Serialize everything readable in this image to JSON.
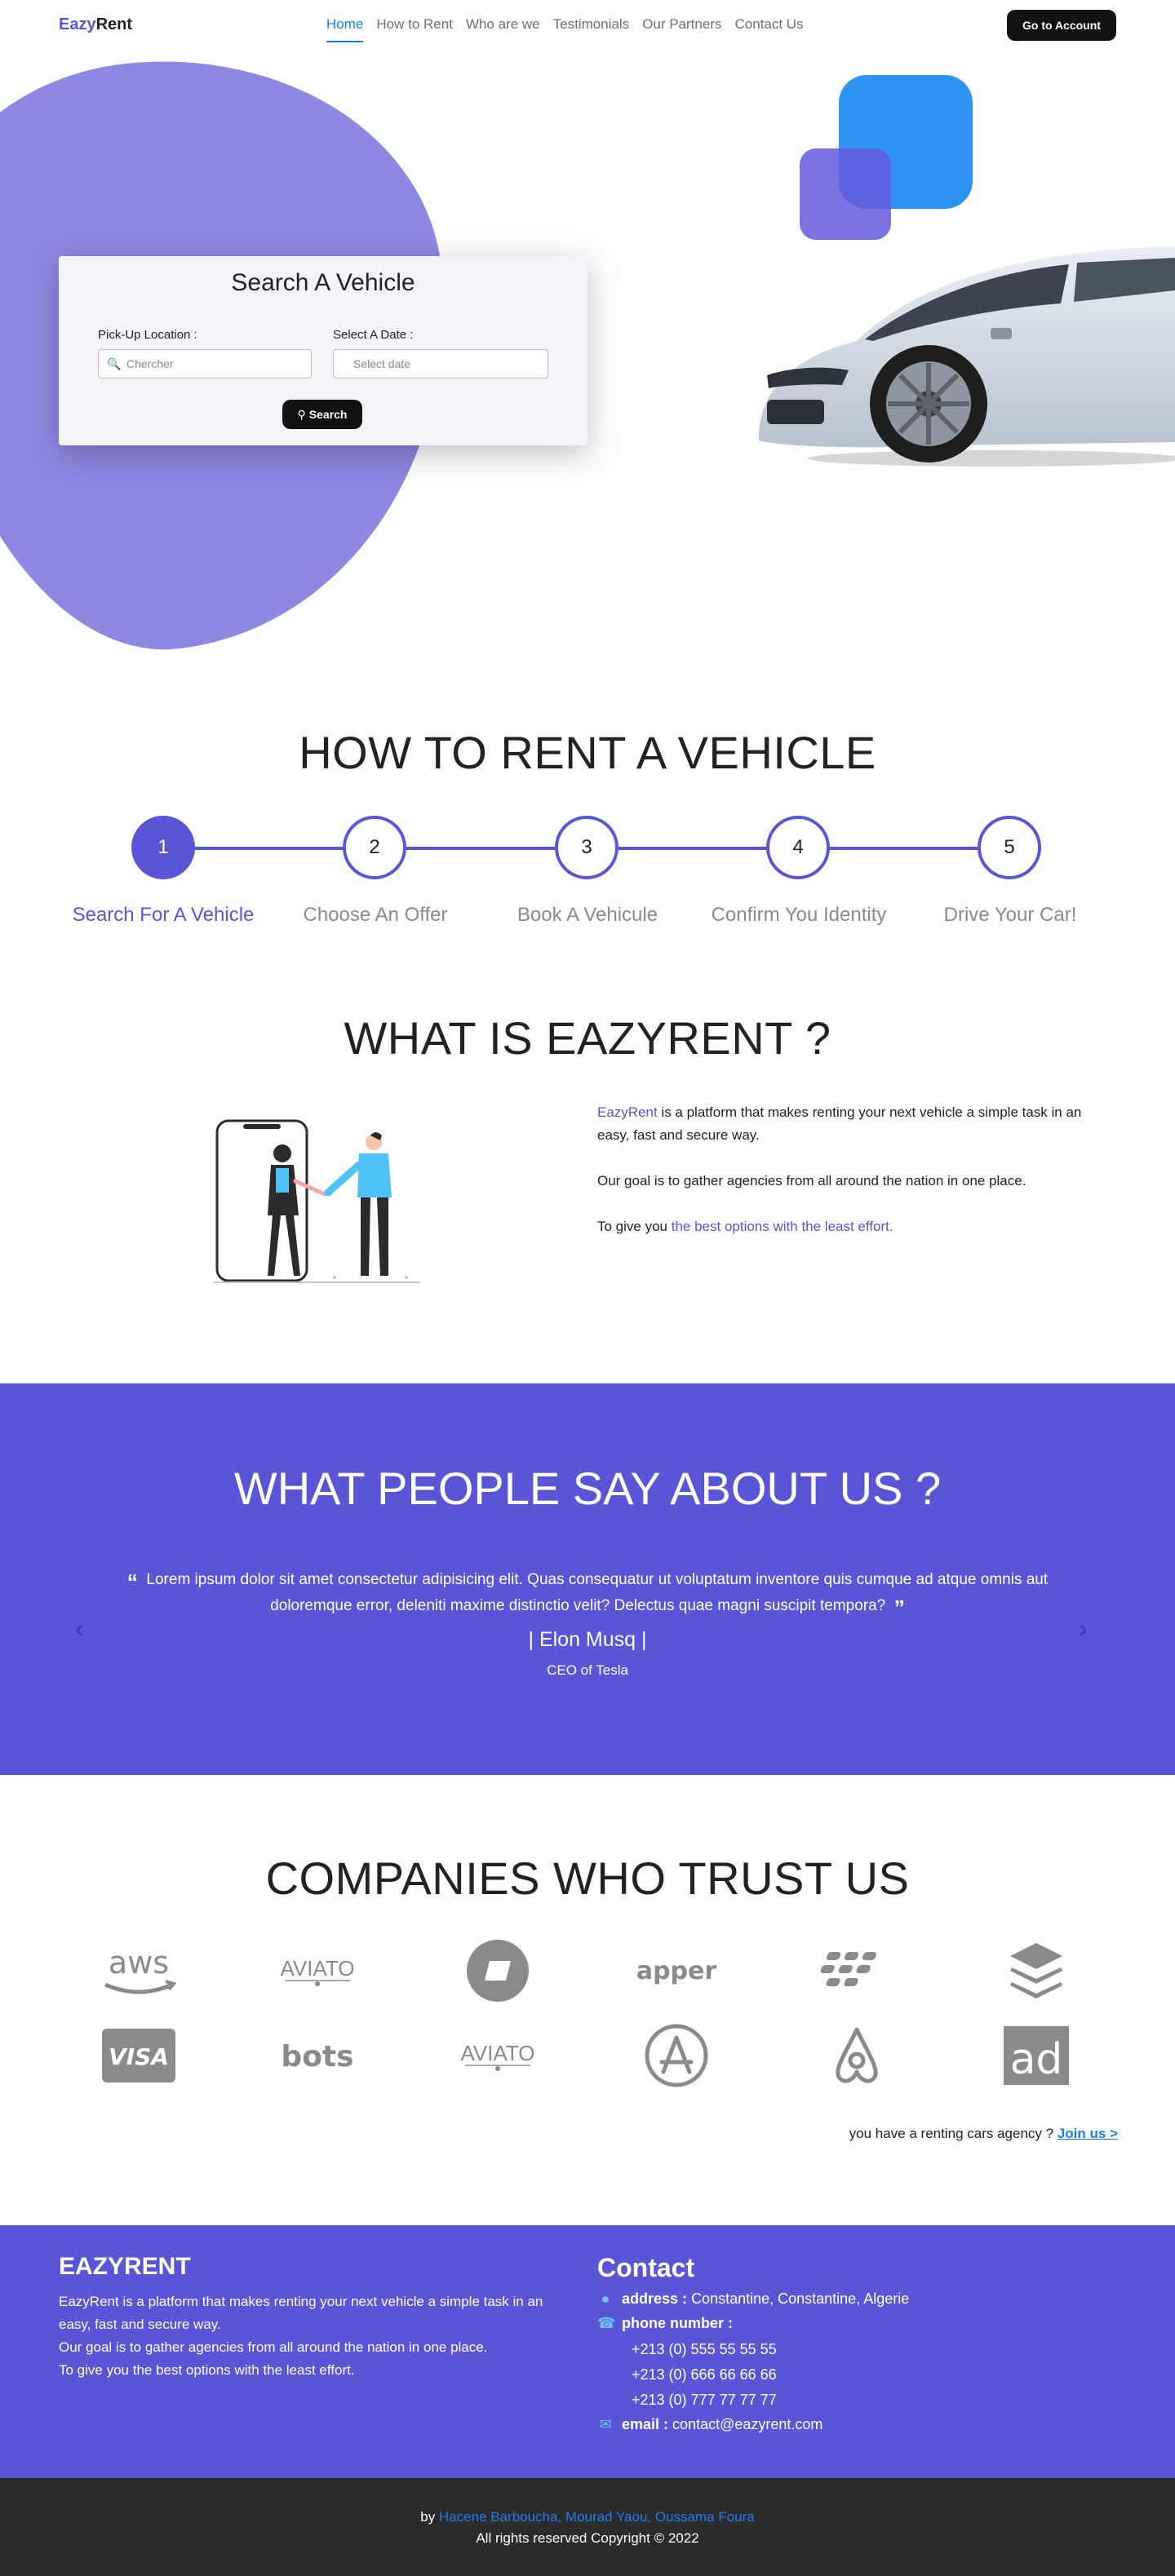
{
  "nav": {
    "logo_part1": "Eazy",
    "logo_part2": "Rent",
    "items": [
      "Home",
      "How to Rent",
      "Who are we",
      "Testimonials",
      "Our Partners",
      "Contact Us"
    ],
    "account_button": "Go to Account"
  },
  "search": {
    "title": "Search A Vehicle",
    "pickup_label": "Pick-Up Location :",
    "pickup_placeholder": "Chercher",
    "date_label": "Select A Date :",
    "date_placeholder": "Select date",
    "button": "Search"
  },
  "how_to": {
    "title": "HOW TO RENT A VEHICLE",
    "steps": [
      {
        "number": "1",
        "label": "Search For A Vehicle"
      },
      {
        "number": "2",
        "label": "Choose An Offer"
      },
      {
        "number": "3",
        "label": "Book A Vehicule"
      },
      {
        "number": "4",
        "label": "Confirm You Identity"
      },
      {
        "number": "5",
        "label": "Drive Your Car!"
      }
    ]
  },
  "what_is": {
    "title": "WHAT IS EAZYRENT ?",
    "p1_highlight": "EazyRent",
    "p1_rest": " is a platform that makes renting your next vehicle a simple task in an easy, fast and secure way.",
    "p2": "Our goal is to gather agencies from all around the nation in one place.",
    "p3_start": "To give you ",
    "p3_highlight": "the best options with the least effort."
  },
  "testimonials": {
    "title": "WHAT PEOPLE SAY ABOUT US ?",
    "quote": "Lorem ipsum dolor sit amet consectetur adipisicing elit. Quas consequatur ut voluptatum inventore quis cumque ad atque omnis aut doloremque error, deleniti maxime distinctio velit? Delectus quae magni suscipit tempora?",
    "author": "| Elon Musq |",
    "role": "CEO of Tesla"
  },
  "companies": {
    "title": "COMPANIES WHO TRUST US",
    "logos": [
      "aws",
      "AVIATO",
      "aviato-circle",
      "apper",
      "blackberry",
      "buffer",
      "VISA",
      "bots",
      "AVIATO",
      "app-store",
      "airbnb",
      "ad"
    ],
    "agency_text": "you have a renting cars agency ? ",
    "join_link": "Join us >"
  },
  "footer": {
    "title": "EAZYRENT",
    "desc_lines": [
      "EazyRent is a platform that makes renting your next vehicle a simple task in an easy, fast and secure way.",
      "Our goal is to gather agencies from all around the nation in one place.",
      "To give you the best options with the least effort."
    ],
    "contact_title": "Contact",
    "address_label": "address :",
    "address_value": "Constantine, Constantine, Algerie",
    "phone_label": "phone number :",
    "phones": [
      "+213 (0) 555 55 55 55",
      "+213 (0) 666 66 66 66",
      "+213 (0) 777 77 77 77"
    ],
    "email_label": "email :",
    "email_value": "contact@eazyrent.com",
    "by": "by ",
    "authors": "Hacene Barboucha, Mourad Yaou, Oussama Foura",
    "copyright": "All rights reserved Copyright © 2022"
  },
  "colors": {
    "primary": "#5a55d6",
    "accent_blue": "#1a7ef0",
    "dark": "#111111"
  }
}
